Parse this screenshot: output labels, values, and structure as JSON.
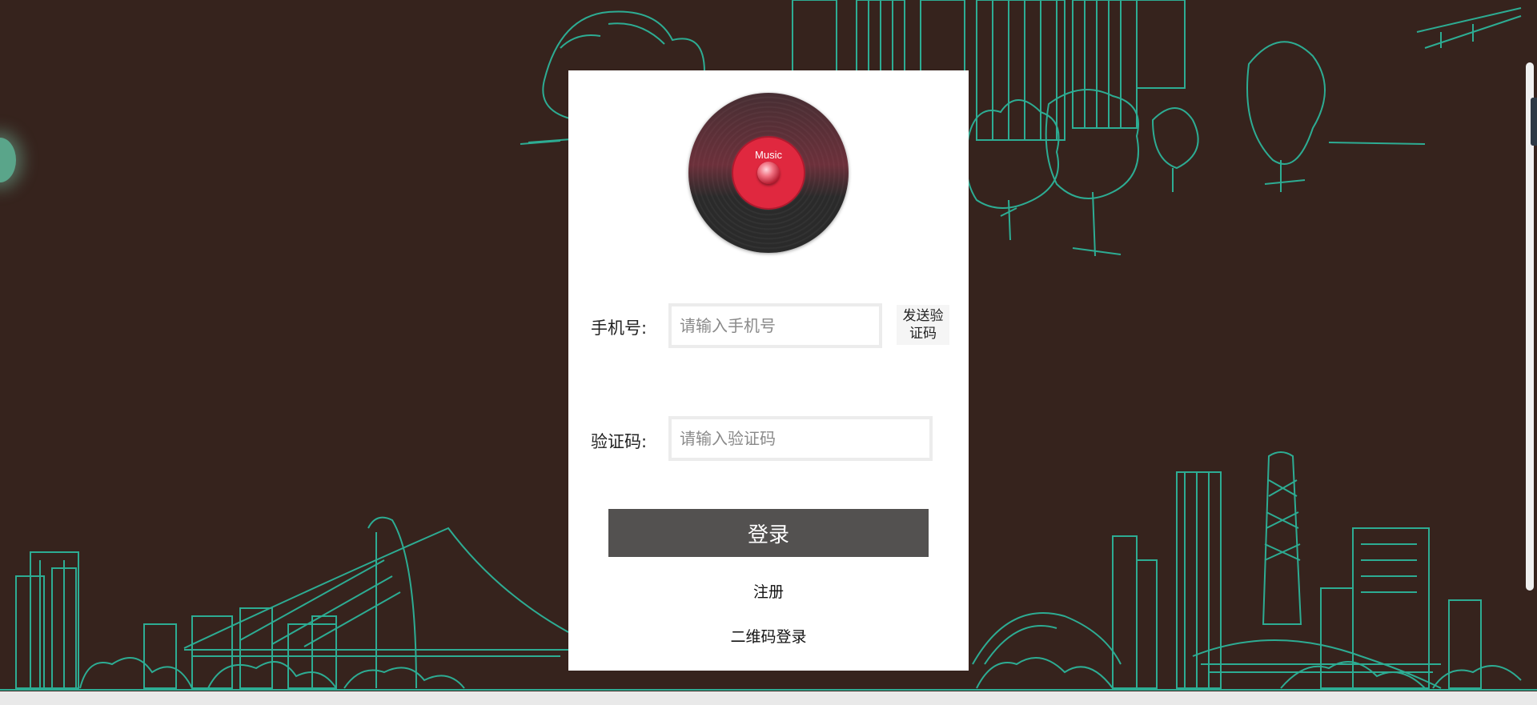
{
  "colors": {
    "background": "#36231d",
    "line_art": "#2cc4a8",
    "login_button": "#535150",
    "vinyl_label": "#e0283f"
  },
  "logo": {
    "icon": "vinyl-record-icon",
    "label_text": "Music"
  },
  "form": {
    "phone_label": "手机号:",
    "phone_placeholder": "请输入手机号",
    "phone_value": "",
    "send_code_label": "发送验证码",
    "code_label": "验证码:",
    "code_placeholder": "请输入验证码",
    "code_value": ""
  },
  "actions": {
    "login_label": "登录",
    "register_label": "注册",
    "qr_login_label": "二维码登录"
  }
}
